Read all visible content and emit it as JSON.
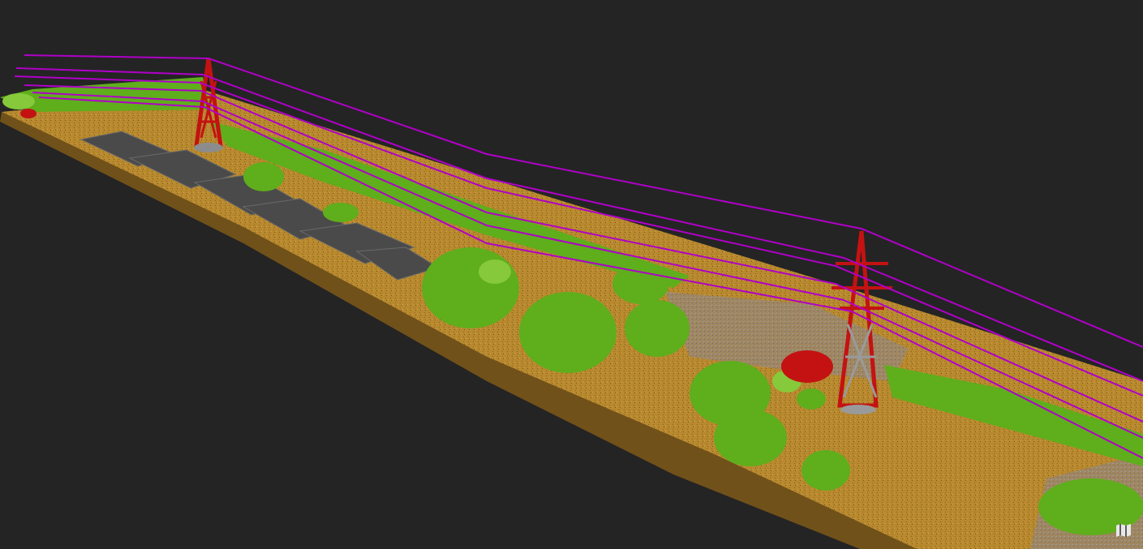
{
  "viewer": {
    "background": "#242424",
    "classes": {
      "ground": "#b8892e",
      "ground_dark": "#8a6420",
      "vegetation": "#5fae1c",
      "vegetation_light": "#86c93a",
      "building": "#4a4a4a",
      "building_light": "#6a6a6a",
      "unclassified": "#8c8c8c",
      "tower": "#c41212",
      "tower_structure": "#9a9a9a",
      "wire": "#b000c8"
    }
  },
  "controls": {
    "map_button_icon": "map-icon"
  }
}
